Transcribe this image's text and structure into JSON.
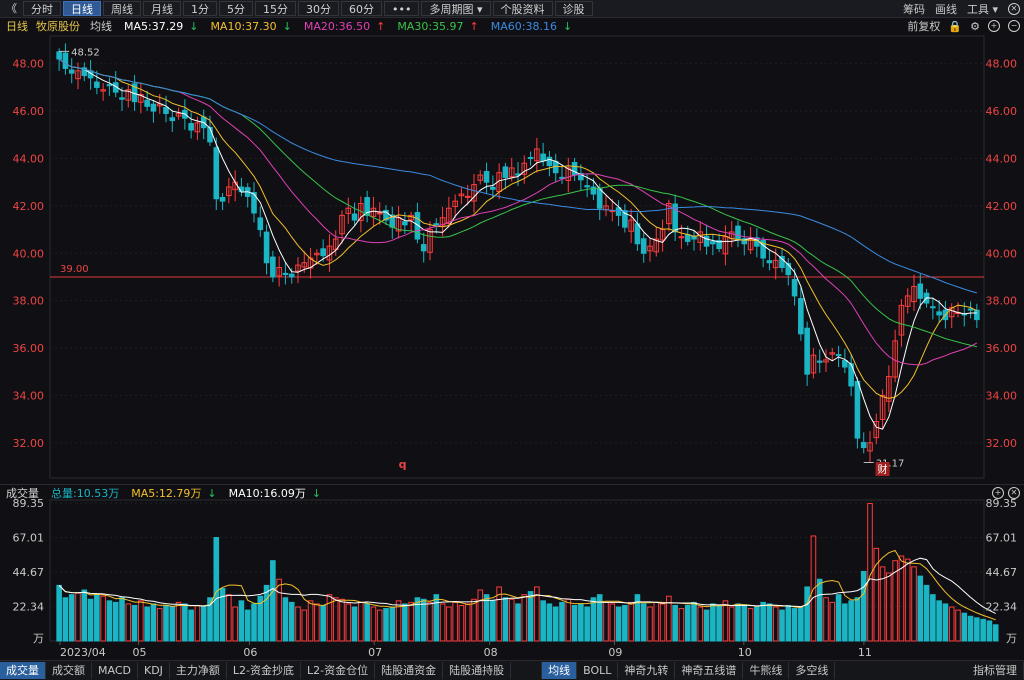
{
  "toolbar": {
    "back": "《",
    "periods": [
      "分时",
      "日线",
      "周线",
      "月线",
      "1分",
      "5分",
      "15分",
      "30分",
      "60分",
      "•••"
    ],
    "active_period": "日线",
    "multi_period": "多周期图",
    "stock_info": "个股资料",
    "diagnosis": "诊股",
    "chips": "筹码",
    "drawing": "画线",
    "tools": "工具"
  },
  "header": {
    "period": "日线",
    "stock_name": "牧原股份",
    "ma_title": "均线",
    "ma5": "MA5:37.29",
    "ma10": "MA10:37.30",
    "ma20": "MA20:36.50",
    "ma30": "MA30:35.97",
    "ma60": "MA60:38.16",
    "adjust": "前复权"
  },
  "colors": {
    "up": "#ff3b3b",
    "down": "#1bb5c4",
    "ma5": "#ffffff",
    "ma10": "#f2c029",
    "ma20": "#e040b5",
    "ma30": "#3ac24a",
    "ma60": "#3a8ae0",
    "hline": "#e23a3a"
  },
  "price_axis": {
    "labels": [
      "48.00",
      "46.00",
      "44.00",
      "42.00",
      "40.00",
      "38.00",
      "36.00",
      "34.00",
      "32.00"
    ]
  },
  "hline_label": "39.00",
  "max_label": "48.52",
  "min_label": "31.17",
  "marker_financial": "财",
  "marker_q": "q",
  "volume": {
    "title": "成交量",
    "total": "总量:10.53万",
    "ma5": "MA5:12.79万",
    "ma10": "MA10:16.09万",
    "axis_labels": [
      "89.35",
      "67.01",
      "44.67",
      "22.34",
      "万"
    ]
  },
  "date_labels": [
    "2023/04",
    "05",
    "06",
    "07",
    "08",
    "09",
    "10",
    "11"
  ],
  "bottom_tabs": [
    "成交量",
    "成交额",
    "MACD",
    "KDJ",
    "主力净额",
    "L2-资金抄底",
    "L2-资金仓位",
    "陆股通资金",
    "陆股通持股",
    "均线",
    "BOLL",
    "神奇九转",
    "神奇五线谱",
    "牛熊线",
    "多空线",
    "指标管理"
  ],
  "chart_data": {
    "type": "candlestick",
    "period": "daily",
    "y_range": [
      30.6,
      49.0
    ],
    "horizontal_line": 39.0,
    "max_price": 48.52,
    "min_price": 31.17,
    "ma_latest": {
      "MA5": 37.29,
      "MA10": 37.3,
      "MA20": 36.5,
      "MA30": 35.97,
      "MA60": 38.16
    },
    "closes": [
      48.2,
      47.8,
      47.6,
      47.7,
      47.5,
      47.4,
      47.0,
      46.9,
      47.1,
      46.8,
      46.5,
      46.9,
      46.4,
      46.7,
      46.2,
      46.0,
      46.3,
      45.9,
      45.6,
      45.9,
      45.7,
      45.2,
      45.5,
      45.3,
      44.7,
      42.3,
      42.2,
      42.8,
      43.0,
      42.6,
      42.4,
      41.7,
      41.0,
      39.6,
      39.0,
      39.4,
      39.1,
      39.0,
      39.5,
      39.6,
      39.8,
      40.0,
      39.9,
      40.3,
      40.6,
      41.6,
      41.9,
      41.4,
      42.1,
      41.6,
      41.9,
      41.7,
      41.4,
      41.1,
      41.5,
      41.2,
      41.6,
      40.6,
      40.1,
      41.0,
      41.2,
      41.5,
      41.9,
      42.2,
      42.5,
      42.4,
      42.9,
      43.3,
      43.0,
      42.7,
      43.4,
      43.2,
      43.6,
      43.3,
      43.8,
      44.0,
      44.4,
      43.9,
      43.7,
      43.4,
      43.2,
      43.6,
      43.3,
      43.1,
      42.8,
      42.5,
      41.9,
      42.0,
      41.8,
      41.6,
      41.1,
      41.4,
      40.4,
      40.0,
      40.3,
      40.6,
      41.0,
      42.1,
      40.9,
      40.7,
      40.5,
      40.6,
      40.9,
      40.3,
      40.4,
      40.2,
      40.7,
      40.9,
      40.6,
      40.4,
      40.6,
      40.3,
      39.8,
      39.6,
      39.7,
      39.4,
      39.1,
      38.2,
      36.6,
      34.9,
      35.7,
      35.4,
      35.5,
      35.8,
      35.7,
      35.2,
      34.4,
      32.2,
      31.8,
      32.0,
      32.9,
      34.0,
      34.8,
      36.3,
      37.8,
      38.2,
      38.6,
      38.1,
      37.9,
      37.7,
      37.4,
      37.2,
      37.7,
      37.5,
      37.4,
      37.6,
      37.2
    ],
    "volumes": [
      36,
      28,
      30,
      31,
      33,
      27,
      30,
      29,
      26,
      25,
      28,
      24,
      23,
      26,
      22,
      24,
      21,
      23,
      22,
      25,
      24,
      20,
      23,
      22,
      28,
      67,
      34,
      30,
      22,
      26,
      20,
      24,
      29,
      36,
      52,
      40,
      28,
      25,
      22,
      20,
      26,
      24,
      23,
      30,
      28,
      27,
      24,
      22,
      25,
      24,
      22,
      20,
      21,
      22,
      26,
      24,
      25,
      28,
      27,
      25,
      30,
      24,
      22,
      25,
      23,
      24,
      27,
      33,
      30,
      26,
      35,
      28,
      27,
      24,
      30,
      32,
      35,
      26,
      24,
      22,
      25,
      27,
      23,
      24,
      22,
      28,
      30,
      25,
      24,
      22,
      23,
      25,
      30,
      24,
      22,
      25,
      24,
      29,
      23,
      21,
      23,
      25,
      22,
      20,
      24,
      23,
      26,
      22,
      24,
      23,
      21,
      22,
      25,
      24,
      22,
      20,
      23,
      21,
      22,
      35,
      68,
      40,
      28,
      25,
      30,
      24,
      26,
      28,
      45,
      89,
      60,
      48,
      44,
      52,
      55,
      53,
      48,
      42,
      36,
      30,
      26,
      24,
      22,
      20,
      18,
      16,
      15,
      14,
      13,
      10.5
    ]
  }
}
